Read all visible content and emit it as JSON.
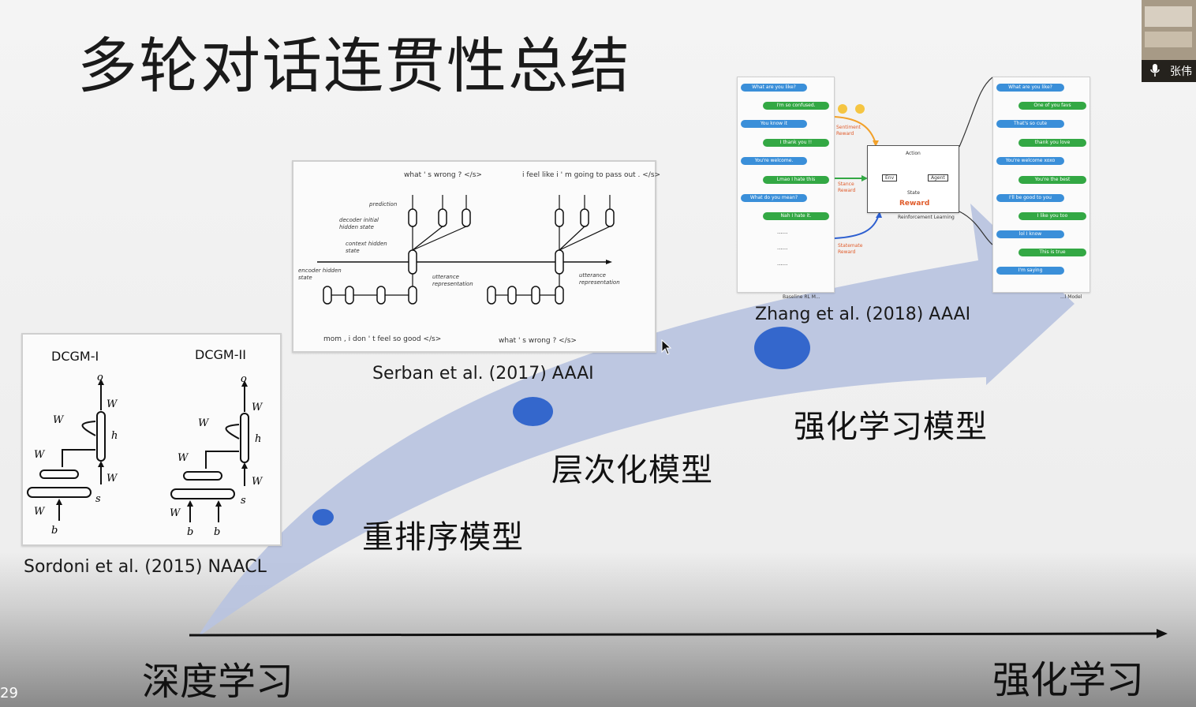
{
  "slide": {
    "title": "多轮对话连贯性总结",
    "axis": {
      "start_label": "深度学习",
      "end_label": "强化学习"
    },
    "stages": [
      {
        "label": "重排序模型"
      },
      {
        "label": "层次化模型"
      },
      {
        "label": "强化学习模型"
      }
    ],
    "citations": {
      "sordoni": "Sordoni et al. (2015) NAACL",
      "serban": "Serban et al. (2017) AAAI",
      "zhang": "Zhang et al. (2018) AAAI"
    },
    "colors": {
      "arc": "#b9c3df",
      "dot": "#3467cc",
      "axis": "#111111"
    }
  },
  "dcgm_figure": {
    "left_title": "DCGM-I",
    "right_title": "DCGM-II"
  },
  "hred_figure": {
    "top_left_text": "what ' s wrong ? </s>",
    "top_right_text": "i feel like i ' m going to pass out . </s>",
    "bottom_left_text": "mom , i don ' t feel so good </s>",
    "bottom_right_text": "what ' s wrong ? </s>",
    "labels": {
      "prediction": "prediction",
      "decoder": "decoder initial hidden state",
      "context": "context hidden state",
      "encoder": "encoder hidden state",
      "utterance1": "utterance representation",
      "utterance2": "utterance representation"
    }
  },
  "rl_figure": {
    "left_dialog": [
      "What are you like?",
      "I'm so confused.",
      "You know it",
      "I thank you !!",
      "You're welcome.",
      "Lmao I hate this",
      "What do you mean?",
      "Nah I hate it."
    ],
    "left_ellipsis": [
      "......",
      "......",
      "......"
    ],
    "rewards": {
      "sentiment": "Sentiment Reward",
      "stance": "Stance Reward",
      "statemate": "Statemate Reward"
    },
    "rl_box": {
      "action": "Action",
      "env": "Env",
      "agent": "Agent",
      "state": "State",
      "reward": "Reward",
      "caption": "Reinforcement Learning"
    },
    "right_dialog": [
      "What are you like?",
      "One of you favs",
      "That's so cute",
      "thank you love",
      "You're welcome xoxo",
      "You're the best",
      "I'll be good to you",
      "I like you too",
      "lol I know",
      "This is true",
      "I'm saying"
    ],
    "left_caption": "Baseline RL M...",
    "right_caption": "...l Model"
  },
  "video": {
    "participant_name": "张伟"
  },
  "corner_text": "29"
}
